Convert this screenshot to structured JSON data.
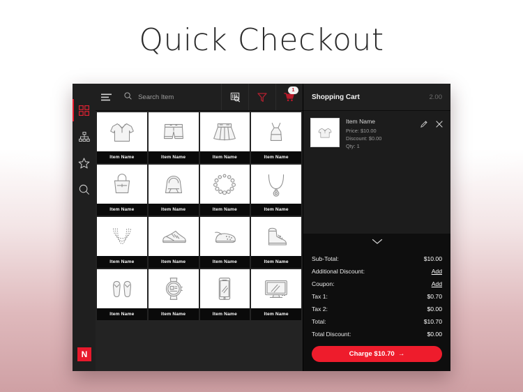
{
  "page": {
    "title": "Quick Checkout"
  },
  "colors": {
    "accent": "#ee1c2c",
    "panel": "#1f1f1f",
    "dark": "#0e0e0e"
  },
  "rail": {
    "items": [
      {
        "icon": "grid-icon",
        "name": "dashboard",
        "active": true
      },
      {
        "icon": "sitemap-icon",
        "name": "categories",
        "active": false
      },
      {
        "icon": "star-icon",
        "name": "favorites",
        "active": false
      },
      {
        "icon": "search-icon",
        "name": "search",
        "active": false
      }
    ],
    "logo_label": "N"
  },
  "topbar": {
    "menu_icon": "hamburger-icon",
    "search": {
      "placeholder": "Search Item",
      "value": ""
    },
    "actions": [
      {
        "icon": "barcode-scan-icon",
        "label": "Scan"
      },
      {
        "icon": "filter-icon",
        "label": "Filter"
      },
      {
        "icon": "cart-icon",
        "label": "Cart",
        "badge": "1"
      }
    ]
  },
  "grid": {
    "items": [
      {
        "label": "Item Name",
        "icon": "polo-shirt-icon"
      },
      {
        "label": "Item Name",
        "icon": "shorts-icon"
      },
      {
        "label": "Item Name",
        "icon": "skirt-icon"
      },
      {
        "label": "Item Name",
        "icon": "dress-icon"
      },
      {
        "label": "Item Name",
        "icon": "tote-bag-icon"
      },
      {
        "label": "Item Name",
        "icon": "handbag-icon"
      },
      {
        "label": "Item Name",
        "icon": "bead-bracelet-icon"
      },
      {
        "label": "Item Name",
        "icon": "pendant-necklace-icon"
      },
      {
        "label": "Item Name",
        "icon": "layered-necklace-icon"
      },
      {
        "label": "Item Name",
        "icon": "sneaker-icon"
      },
      {
        "label": "Item Name",
        "icon": "clog-icon"
      },
      {
        "label": "Item Name",
        "icon": "boot-icon"
      },
      {
        "label": "Item Name",
        "icon": "flip-flops-icon"
      },
      {
        "label": "Item Name",
        "icon": "smartwatch-icon"
      },
      {
        "label": "Item Name",
        "icon": "smartphone-icon"
      },
      {
        "label": "Item Name",
        "icon": "monitor-icon"
      }
    ]
  },
  "cart": {
    "title": "Shopping Cart",
    "count": "2.00",
    "item": {
      "name": "Item Name",
      "price": "Price: $10.00",
      "discount": "Discount: $0.00",
      "qty": "Qty: 1",
      "thumb_icon": "polo-shirt-icon",
      "edit_icon": "pencil-icon",
      "remove_icon": "close-icon"
    },
    "collapse_icon": "chevron-down-icon",
    "totals": [
      {
        "label": "Sub-Total:",
        "value": "$10.00",
        "link": false
      },
      {
        "label": "Additional Discount:",
        "value": "Add",
        "link": true
      },
      {
        "label": "Coupon:",
        "value": "Add",
        "link": true
      },
      {
        "label": "Tax 1:",
        "value": "$0.70",
        "link": false
      },
      {
        "label": "Tax 2:",
        "value": "$0.00",
        "link": false
      },
      {
        "label": "Total:",
        "value": "$10.70",
        "link": false
      },
      {
        "label": "Total Discount:",
        "value": "$0.00",
        "link": false
      }
    ],
    "charge_label": "Charge $10.70",
    "charge_arrow": "→"
  }
}
